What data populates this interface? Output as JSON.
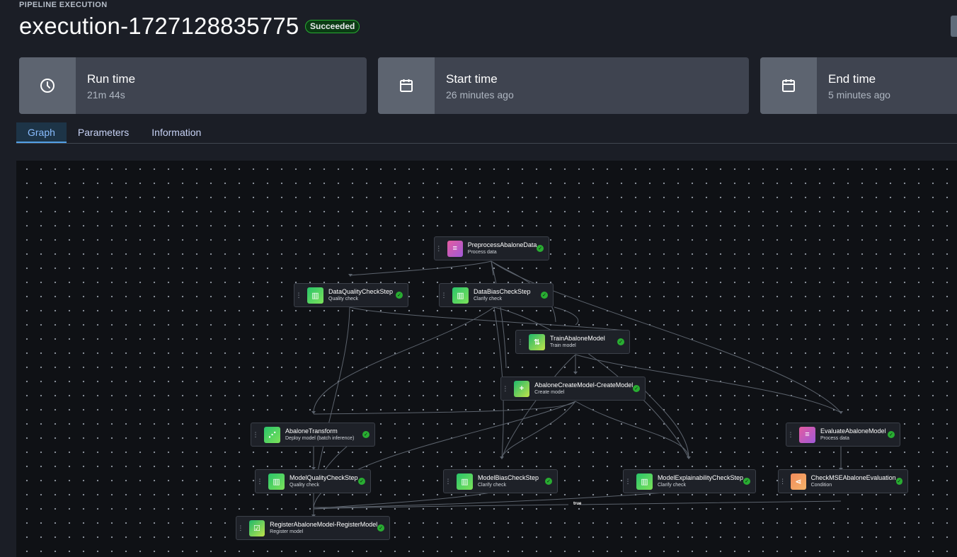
{
  "header": {
    "eyebrow": "PIPELINE EXECUTION",
    "title": "execution-1727128835775",
    "status": "Succeeded"
  },
  "cards": [
    {
      "label": "Run time",
      "value": "21m 44s",
      "icon": "clock-icon"
    },
    {
      "label": "Start time",
      "value": "26 minutes ago",
      "icon": "calendar-icon"
    },
    {
      "label": "End time",
      "value": "5 minutes ago",
      "icon": "calendar-icon"
    }
  ],
  "tabs": [
    {
      "label": "Graph",
      "active": true
    },
    {
      "label": "Parameters",
      "active": false
    },
    {
      "label": "Information",
      "active": false
    }
  ],
  "graph": {
    "nodes": [
      {
        "name": "PreprocessAbaloneData",
        "type": "Process data",
        "icon": "processing-icon",
        "status": "succeeded"
      },
      {
        "name": "DataQualityCheckStep",
        "type": "Quality check",
        "icon": "quality-check-icon",
        "status": "succeeded"
      },
      {
        "name": "DataBiasCheckStep",
        "type": "Clarify check",
        "icon": "clarify-check-icon",
        "status": "succeeded"
      },
      {
        "name": "TrainAbaloneModel",
        "type": "Train model",
        "icon": "training-icon",
        "status": "succeeded"
      },
      {
        "name": "AbaloneCreateModel-CreateModel",
        "type": "Create model",
        "icon": "create-model-icon",
        "status": "succeeded"
      },
      {
        "name": "AbaloneTransform",
        "type": "Deploy model (batch inference)",
        "icon": "transform-icon",
        "status": "succeeded"
      },
      {
        "name": "EvaluateAbaloneModel",
        "type": "Process data",
        "icon": "processing-icon",
        "status": "succeeded"
      },
      {
        "name": "ModelQualityCheckStep",
        "type": "Quality check",
        "icon": "quality-check-icon",
        "status": "succeeded"
      },
      {
        "name": "ModelBiasCheckStep",
        "type": "Clarify check",
        "icon": "clarify-check-icon",
        "status": "succeeded"
      },
      {
        "name": "ModelExplainabilityCheckStep",
        "type": "Clarify check",
        "icon": "clarify-check-icon",
        "status": "succeeded"
      },
      {
        "name": "CheckMSEAbaloneEvaluation",
        "type": "Condition",
        "icon": "condition-icon",
        "status": "succeeded"
      },
      {
        "name": "RegisterAbaloneModel-RegisterModel",
        "type": "Register model",
        "icon": "register-model-icon",
        "status": "succeeded"
      }
    ],
    "edge_label": "true"
  }
}
